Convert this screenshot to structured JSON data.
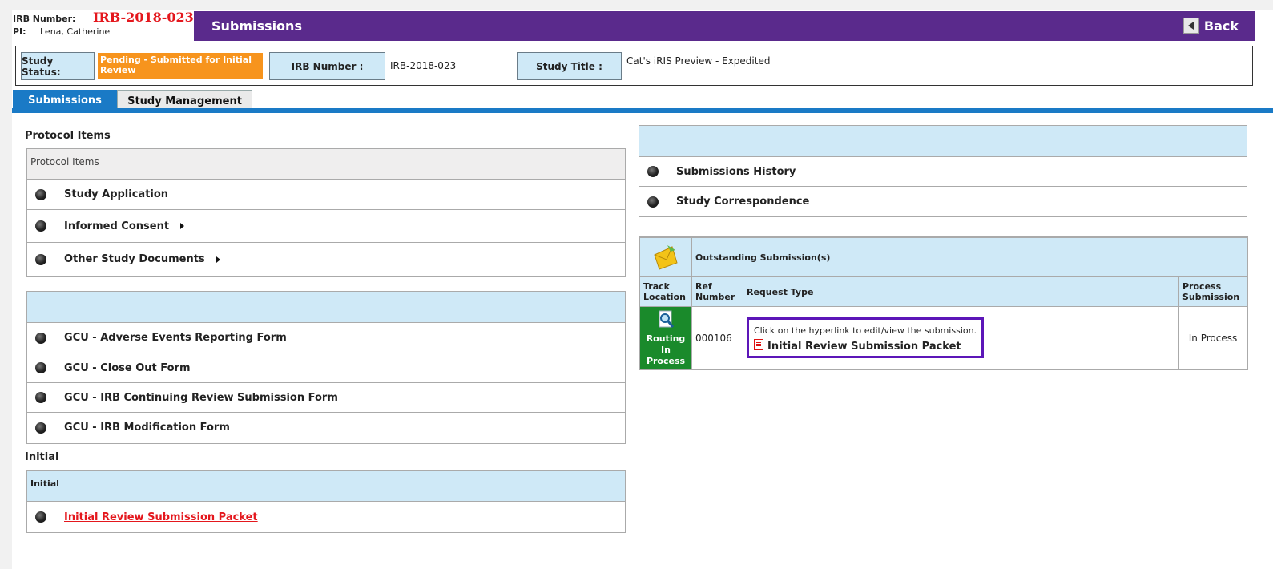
{
  "header": {
    "irb_label": "IRB Number:",
    "irb_value": "IRB-2018-023",
    "pi_label": "PI:",
    "pi_value": "Lena, Catherine",
    "title": "Submissions",
    "back_label": "Back"
  },
  "status": {
    "study_status_label": "Study Status:",
    "study_status_value": "Pending - Submitted for Initial Review",
    "irb_label": "IRB Number :",
    "irb_value": "IRB-2018-023",
    "title_label": "Study Title :",
    "title_value": "Cat's iRIS Preview - Expedited"
  },
  "tabs": [
    {
      "label": "Submissions",
      "active": true
    },
    {
      "label": "Study Management",
      "active": false
    }
  ],
  "protocol": {
    "section_title": "Protocol Items",
    "panel_header": "Protocol Items",
    "items": [
      {
        "label": "Study Application"
      },
      {
        "label": "Informed Consent"
      },
      {
        "label": "Other Study Documents"
      }
    ]
  },
  "forms": {
    "items": [
      {
        "label": "GCU - Adverse Events Reporting Form"
      },
      {
        "label": "GCU - Close Out Form"
      },
      {
        "label": "GCU - IRB Continuing Review Submission Form"
      },
      {
        "label": "GCU - IRB Modification Form"
      }
    ]
  },
  "initial": {
    "section_title": "Initial",
    "panel_header": "Initial",
    "link": "Initial Review Submission Packet"
  },
  "history": {
    "items": [
      {
        "label": "Submissions History"
      },
      {
        "label": "Study Correspondence"
      }
    ]
  },
  "outstanding": {
    "title": "Outstanding Submission(s)",
    "columns": [
      "Track Location",
      "Ref Number",
      "Request Type",
      "Process Submission"
    ],
    "row": {
      "track": "Routing In Process",
      "ref": "000106",
      "hint": "Click on the hyperlink to edit/view the submission.",
      "link": "Initial Review Submission Packet",
      "process": "In Process"
    }
  },
  "colors": {
    "purple": "#5a2a8c",
    "tab_blue": "#1a7ac6",
    "light_blue": "#cfe9f7",
    "pending_orange": "#f7941d",
    "irb_red": "#e4171d",
    "routing_green": "#1a8a2b"
  }
}
